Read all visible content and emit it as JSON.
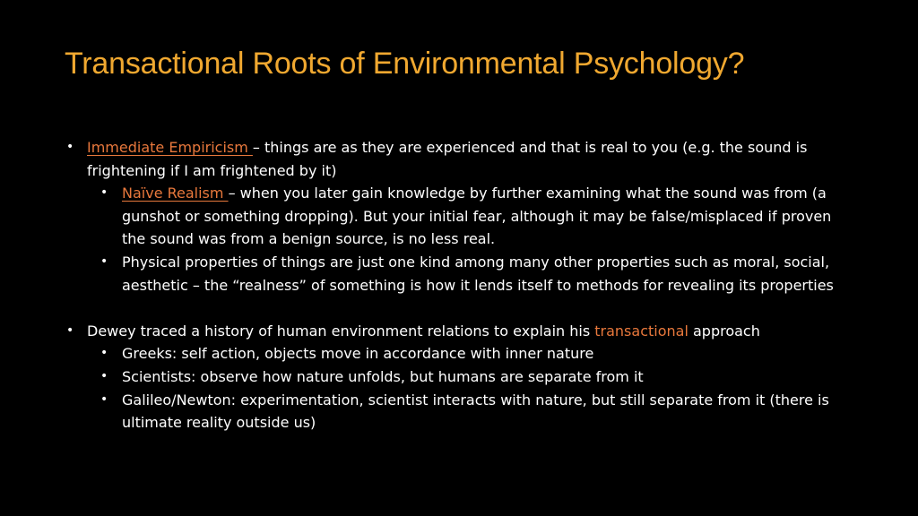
{
  "colors": {
    "background": "#000000",
    "title": "#f0a830",
    "text": "#ffffff",
    "accent": "#e8783c"
  },
  "slide": {
    "title": "Transactional Roots of Environmental Psychology?",
    "bullet_glyph": "•",
    "section1": {
      "term": "Immediate Empiricism ",
      "text": "– things are as they are experienced and that is real to you (e.g. the sound is frightening if I am frightened by it)",
      "sub": [
        {
          "term": "Naïve Realism ",
          "text": "– when you later gain knowledge by further examining what the sound was from (a gunshot or something dropping). But your initial fear, although it may be false/misplaced if proven the sound was from a benign source, is no less real."
        },
        {
          "text": "Physical properties of things are just one kind among many other properties such as moral, social, aesthetic – the “realness” of something is how it lends itself to methods for revealing its properties"
        }
      ]
    },
    "section2": {
      "text_before": "Dewey traced a history of human environment relations to explain his ",
      "accent_word": "transactional",
      "text_after": " approach",
      "sub": [
        {
          "text": "Greeks: self action, objects move in accordance with inner nature"
        },
        {
          "text": "Scientists: observe how nature unfolds, but humans are separate from it"
        },
        {
          "text": "Galileo/Newton: experimentation, scientist interacts with nature, but still separate from it (there is ultimate reality outside us)"
        }
      ]
    }
  }
}
